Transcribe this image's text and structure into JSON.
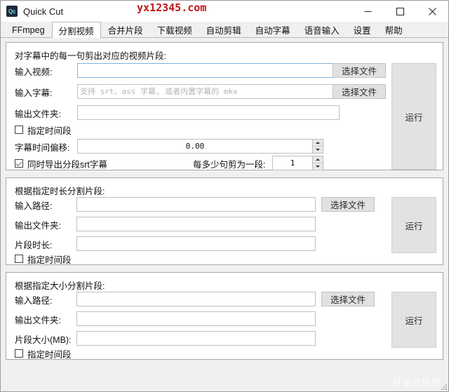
{
  "window": {
    "title": "Quick Cut",
    "icon_label": "Qc",
    "icon_name": "app-icon",
    "controls": {
      "minimize": "minimize-icon",
      "maximize": "maximize-icon",
      "close": "close-icon"
    }
  },
  "watermarks": {
    "top": "yx12345.com",
    "bottom": "目录号码网"
  },
  "tabs": [
    {
      "label": "FFmpeg",
      "active": false
    },
    {
      "label": "分割视频",
      "active": true
    },
    {
      "label": "合并片段",
      "active": false
    },
    {
      "label": "下载视频",
      "active": false
    },
    {
      "label": "自动剪辑",
      "active": false
    },
    {
      "label": "自动字幕",
      "active": false
    },
    {
      "label": "语音输入",
      "active": false
    },
    {
      "label": "设置",
      "active": false
    },
    {
      "label": "帮助",
      "active": false
    }
  ],
  "sections": {
    "subtitle_split": {
      "title": "对字幕中的每一句剪出对应的视频片段:",
      "input_video_label": "输入视频:",
      "input_video_value": "",
      "input_video_placeholder": "",
      "input_subtitle_label": "输入字幕:",
      "input_subtitle_value": "",
      "input_subtitle_placeholder": "支持 srt、ass 字幕, 或者内置字幕的 mkv",
      "output_folder_label": "输出文件夹:",
      "output_folder_value": "",
      "time_range_checkbox": "指定时间段",
      "time_range_checked": false,
      "offset_label": "字幕时间偏移:",
      "offset_value": "0.00",
      "export_srt_checkbox": "同时导出分段srt字幕",
      "export_srt_checked": true,
      "sentences_label": "每多少句剪为一段:",
      "sentences_value": "1",
      "choose_file_1": "选择文件",
      "choose_file_2": "选择文件",
      "run": "运行"
    },
    "duration_split": {
      "title": "根据指定时长分割片段:",
      "input_path_label": "输入路径:",
      "input_path_value": "",
      "output_folder_label": "输出文件夹:",
      "output_folder_value": "",
      "duration_label": "片段时长:",
      "duration_value": "",
      "time_range_checkbox": "指定时间段",
      "time_range_checked": false,
      "choose_file": "选择文件",
      "run": "运行"
    },
    "size_split": {
      "title": "根据指定大小分割片段:",
      "input_path_label": "输入路径:",
      "input_path_value": "",
      "output_folder_label": "输出文件夹:",
      "output_folder_value": "",
      "size_label": "片段大小(MB):",
      "size_value": "",
      "time_range_checkbox": "指定时间段",
      "time_range_checked": false,
      "choose_file": "选择文件",
      "run": "运行"
    }
  },
  "colors": {
    "window_bg": "#f0f0f0",
    "panel_bg": "#ffffff",
    "button_bg": "#e1e1e1",
    "focus_border": "#7eb4e2",
    "watermark_red": "#c01818",
    "icon_bg": "#1d2b3a",
    "icon_fg": "#6fd8e8"
  }
}
